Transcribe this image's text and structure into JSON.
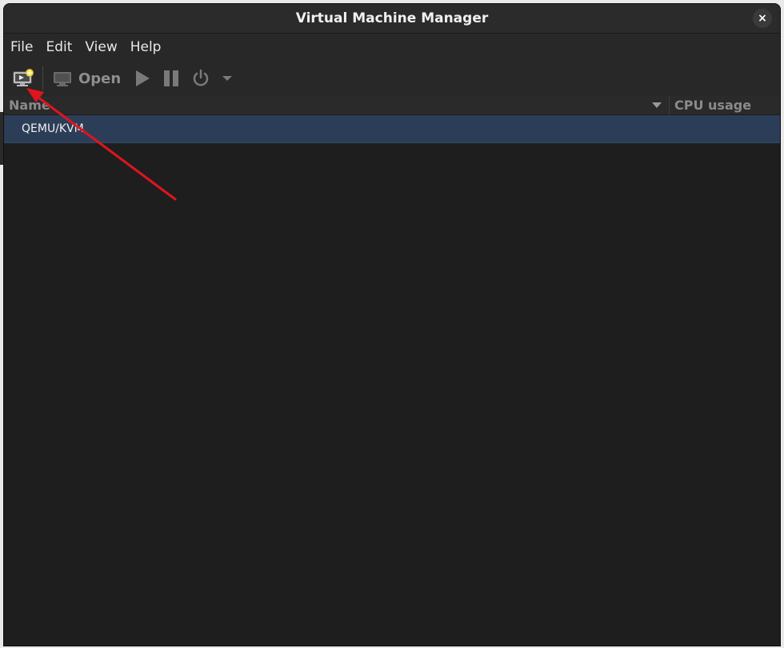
{
  "window": {
    "title": "Virtual Machine Manager",
    "close_label": "×"
  },
  "menubar": {
    "items": [
      "File",
      "Edit",
      "View",
      "Help"
    ]
  },
  "toolbar": {
    "new_vm_icon": "new-vm-icon",
    "open_label": "Open",
    "icons": [
      "monitor-icon",
      "play-icon",
      "pause-icon",
      "power-icon",
      "dropdown-arrow-icon"
    ]
  },
  "list": {
    "columns": [
      "Name",
      "CPU usage"
    ],
    "rows": [
      {
        "name": "QEMU/KVM"
      }
    ]
  },
  "annotation": {
    "color": "#e0141e"
  }
}
